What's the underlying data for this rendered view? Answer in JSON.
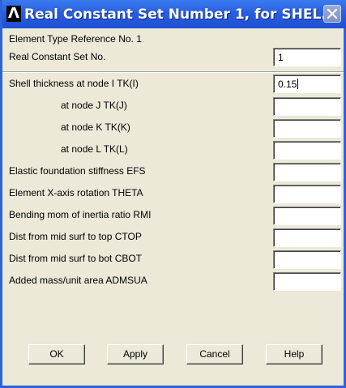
{
  "window": {
    "title": "Real Constant Set Number 1, for SHEL...",
    "app_icon": "ansys-logo-icon",
    "close_icon": "close-icon"
  },
  "header": {
    "element_type_ref": "Element Type Reference No. 1",
    "real_const_set_label": "Real Constant Set No.",
    "real_const_set_value": "1"
  },
  "params": [
    {
      "label": "Shell thickness at node I  TK(I)",
      "value": "0.15"
    },
    {
      "label": "at node J  TK(J)",
      "value": ""
    },
    {
      "label": "at node K  TK(K)",
      "value": ""
    },
    {
      "label": "at node L  TK(L)",
      "value": ""
    },
    {
      "label": "Elastic foundation stiffness EFS",
      "value": ""
    },
    {
      "label": "Element X-axis rotation     THETA",
      "value": ""
    },
    {
      "label": "Bending mom of inertia ratio RMI",
      "value": ""
    },
    {
      "label": "Dist from mid surf to top    CTOP",
      "value": ""
    },
    {
      "label": "Dist from mid surf to bot    CBOT",
      "value": ""
    },
    {
      "label": "Added mass/unit area       ADMSUA",
      "value": ""
    }
  ],
  "buttons": {
    "ok": "OK",
    "apply": "Apply",
    "cancel": "Cancel",
    "help": "Help"
  }
}
